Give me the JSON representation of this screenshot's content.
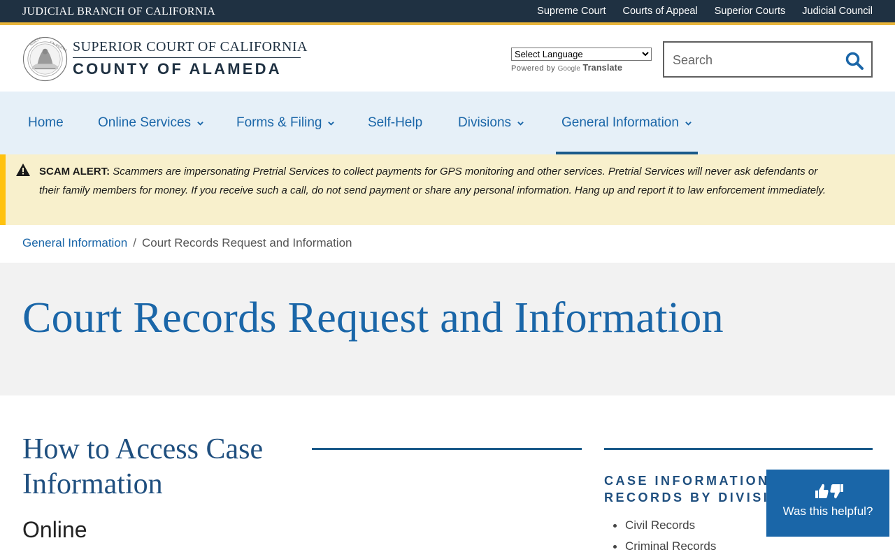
{
  "topbar": {
    "brand": "JUDICIAL BRANCH OF CALIFORNIA",
    "links": [
      "Supreme Court",
      "Courts of Appeal",
      "Superior Courts",
      "Judicial Council"
    ]
  },
  "header": {
    "logo_line1": "SUPERIOR COURT OF CALIFORNIA",
    "logo_line2": "COUNTY OF ALAMEDA",
    "language_select_value": "Select Language",
    "powered_by": "Powered by",
    "google": "Google",
    "translate": "Translate",
    "search_placeholder": "Search"
  },
  "nav": {
    "items": [
      {
        "label": "Home",
        "has_dropdown": false
      },
      {
        "label": "Online Services",
        "has_dropdown": true
      },
      {
        "label": "Forms & Filing",
        "has_dropdown": true
      },
      {
        "label": "Self-Help",
        "has_dropdown": false
      },
      {
        "label": "Divisions",
        "has_dropdown": true
      },
      {
        "label": "General Information",
        "has_dropdown": true,
        "active": true
      }
    ]
  },
  "alert": {
    "label": "SCAM ALERT:",
    "message": "Scammers are impersonating Pretrial Services to collect payments for GPS monitoring and other services.  Pretrial Services will never ask defendants or their family members for money. If you receive such a call, do not send payment or share any personal information.  Hang up and report it to law enforcement immediately."
  },
  "breadcrumb": {
    "parent": "General Information",
    "separator": "/",
    "current": "Court Records Request and Information"
  },
  "page": {
    "title": "Court Records Request and Information",
    "section_heading": "How to Access Case Information",
    "subheading": "Online"
  },
  "sidebar": {
    "title": "CASE INFORMATION & RECORDS BY DIVISION",
    "items": [
      "Civil Records",
      "Criminal Records"
    ]
  },
  "feedback": {
    "label": "Was this helpful?"
  },
  "colors": {
    "topbar_bg": "#1f3142",
    "accent_gold": "#e9b53a",
    "link_blue": "#1a66a8",
    "nav_bg": "#e6f0f8",
    "alert_bg": "#f8f0cc",
    "alert_stripe": "#ffc20e",
    "title_band_bg": "#f2f2f2"
  },
  "icons": {
    "search": "magnifier-icon",
    "alert": "warning-triangle-icon",
    "dropdown": "chevron-down-icon",
    "feedback": "thumbs-up-down-icon",
    "seal": "court-seal-icon"
  }
}
